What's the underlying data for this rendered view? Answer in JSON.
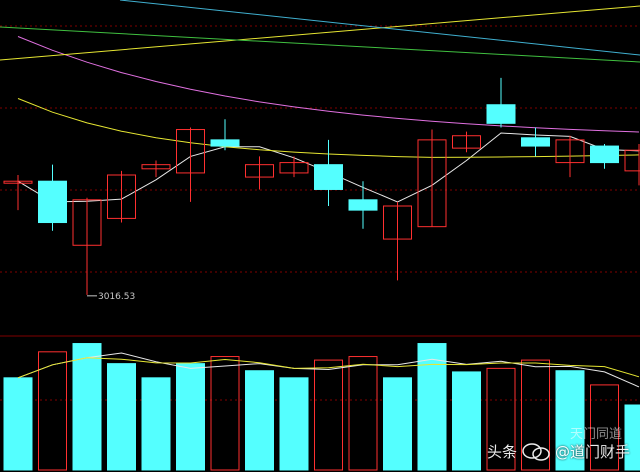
{
  "chart_data": {
    "type": "candlestick",
    "title": "",
    "low_label": "3016.53",
    "ylim": [
      3000,
      3150
    ],
    "candles": [
      {
        "o": 3072,
        "c": 3072,
        "h": 3075,
        "l": 3058,
        "up": true
      },
      {
        "o": 3072,
        "c": 3052,
        "h": 3080,
        "l": 3048,
        "up": false
      },
      {
        "o": 3041,
        "c": 3063,
        "h": 3064,
        "l": 3017,
        "up": true
      },
      {
        "o": 3054,
        "c": 3075,
        "h": 3077,
        "l": 3052,
        "up": true
      },
      {
        "o": 3078,
        "c": 3080,
        "h": 3082,
        "l": 3074,
        "up": true
      },
      {
        "o": 3076,
        "c": 3097,
        "h": 3098,
        "l": 3062,
        "up": true
      },
      {
        "o": 3092,
        "c": 3089,
        "h": 3102,
        "l": 3087,
        "up": false
      },
      {
        "o": 3074,
        "c": 3080,
        "h": 3084,
        "l": 3068,
        "up": true
      },
      {
        "o": 3076,
        "c": 3081,
        "h": 3084,
        "l": 3074,
        "up": true
      },
      {
        "o": 3080,
        "c": 3068,
        "h": 3092,
        "l": 3060,
        "up": false
      },
      {
        "o": 3063,
        "c": 3058,
        "h": 3072,
        "l": 3049,
        "up": false
      },
      {
        "o": 3044,
        "c": 3060,
        "h": 3062,
        "l": 3024,
        "up": true
      },
      {
        "o": 3050,
        "c": 3092,
        "h": 3097,
        "l": 3050,
        "up": true
      },
      {
        "o": 3088,
        "c": 3094,
        "h": 3096,
        "l": 3086,
        "up": true
      },
      {
        "o": 3109,
        "c": 3100,
        "h": 3122,
        "l": 3098,
        "up": false
      },
      {
        "o": 3093,
        "c": 3089,
        "h": 3098,
        "l": 3084,
        "up": false
      },
      {
        "o": 3081,
        "c": 3092,
        "h": 3094,
        "l": 3074,
        "up": true
      },
      {
        "o": 3089,
        "c": 3081,
        "h": 3090,
        "l": 3078,
        "up": false
      },
      {
        "o": 3077,
        "c": 3087,
        "h": 3090,
        "l": 3070,
        "up": true
      }
    ],
    "volumes": [
      0.78,
      1.0,
      1.07,
      0.9,
      0.78,
      0.9,
      0.96,
      0.84,
      0.78,
      0.93,
      0.96,
      0.78,
      1.07,
      0.83,
      0.86,
      0.93,
      0.84,
      0.72,
      0.55
    ],
    "volume_up": [
      true,
      false,
      true,
      true,
      true,
      true,
      false,
      true,
      true,
      false,
      false,
      true,
      true,
      true,
      false,
      false,
      true,
      false,
      true
    ],
    "colors": {
      "up": "#ff3030",
      "down": "#54ffff",
      "ma_white": "#e8e8e8",
      "ma_yellow": "#e6e632",
      "ma_magenta": "#e070e0",
      "ma_green": "#40c040",
      "ma_cyan": "#40b0d0",
      "grid": "#800000"
    }
  },
  "watermark": {
    "prefix": "头条",
    "handle": "@道门财手",
    "faint": "天门同道"
  }
}
